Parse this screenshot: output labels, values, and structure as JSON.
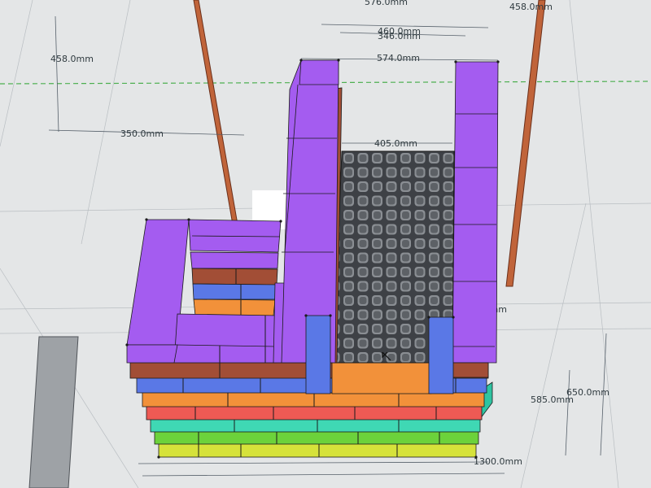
{
  "app": {
    "colors": {
      "background": "#e4e6e7",
      "guide_green": "#4caf50",
      "pole_brown": "#c0643a",
      "dim_line": "#56606a",
      "edge": "#1b1b1b"
    }
  },
  "dimensions": {
    "d_576": "576.0mm",
    "d_458_top": "458.0mm",
    "d_460": "460.0mm",
    "d_346": "346.0mm",
    "d_574": "574.0mm",
    "d_458_left": "458.0mm",
    "d_350": "350.0mm",
    "d_405": "405.0mm",
    "d_1148": "1148.0mm",
    "d_650": "650.0mm",
    "d_585": "585.0mm",
    "d_1300": "1300.0mm"
  },
  "model": {
    "icons": [
      "move-cursor-icon"
    ],
    "layers": [
      {
        "name": "yellow",
        "color": "#d6e23a"
      },
      {
        "name": "green",
        "color": "#6cd23b"
      },
      {
        "name": "teal",
        "color": "#3fd8b4"
      },
      {
        "name": "red",
        "color": "#ee5a54"
      },
      {
        "name": "orange",
        "color": "#f2913a"
      },
      {
        "name": "blue",
        "color": "#5a78e6"
      },
      {
        "name": "brown",
        "color": "#a24e36"
      },
      {
        "name": "purple",
        "color": "#a45cf0"
      },
      {
        "name": "grate",
        "color": "#4a4d52"
      }
    ]
  }
}
